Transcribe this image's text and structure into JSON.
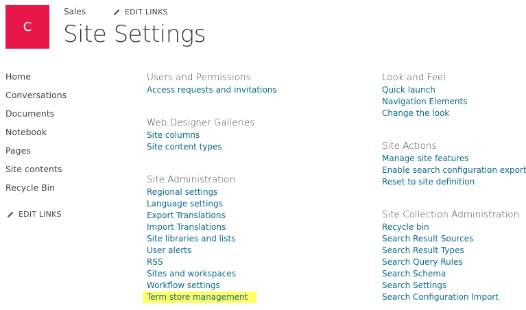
{
  "header": {
    "logo_letter": "C",
    "site_name": "Sales",
    "edit_links": "EDIT LINKS",
    "page_title": "Site Settings",
    "logo_color": "#e8174a"
  },
  "left_nav": {
    "items": [
      "Home",
      "Conversations",
      "Documents",
      "Notebook",
      "Pages",
      "Site contents",
      "Recycle Bin"
    ],
    "edit_links": "EDIT LINKS"
  },
  "columns": {
    "middle": [
      {
        "title": "Users and Permissions",
        "links": [
          "Access requests and invitations"
        ]
      },
      {
        "title": "Web Designer Galleries",
        "links": [
          "Site columns",
          "Site content types"
        ]
      },
      {
        "title": "Site Administration",
        "links": [
          "Regional settings",
          "Language settings",
          "Export Translations",
          "Import Translations",
          "Site libraries and lists",
          "User alerts",
          "RSS",
          "Sites and workspaces",
          "Workflow settings",
          "Term store management"
        ]
      }
    ],
    "right": [
      {
        "title": "Look and Feel",
        "links": [
          "Quick launch",
          "Navigation Elements",
          "Change the look"
        ]
      },
      {
        "title": "Site Actions",
        "links": [
          "Manage site features",
          "Enable search configuration export",
          "Reset to site definition"
        ]
      },
      {
        "title": "Site Collection Administration",
        "links": [
          "Recycle bin",
          "Search Result Sources",
          "Search Result Types",
          "Search Query Rules",
          "Search Schema",
          "Search Settings",
          "Search Configuration Import"
        ]
      }
    ]
  },
  "highlighted_link": "Term store management",
  "colors": {
    "link": "#0b6a8a",
    "highlight": "#ffff66"
  }
}
